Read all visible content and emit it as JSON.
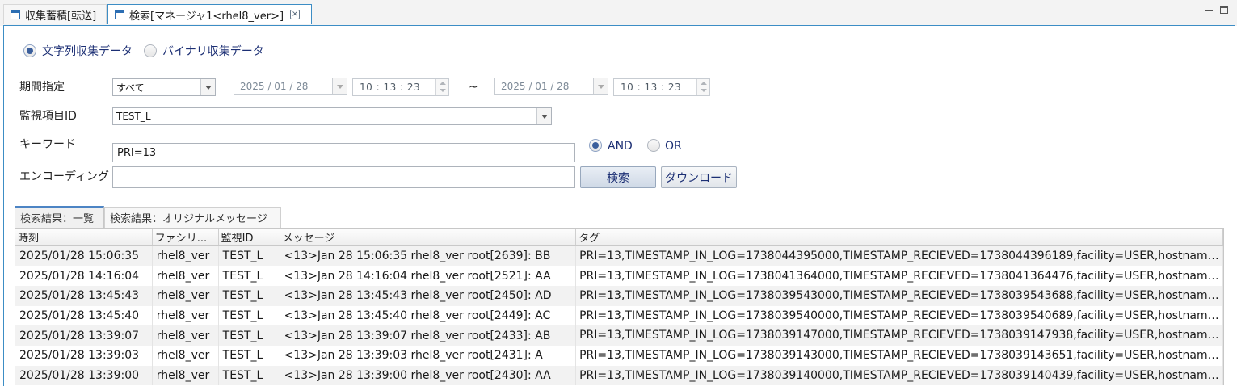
{
  "tabs": {
    "inactive_label": "収集蓄積[転送]",
    "active_label": "検索[マネージャ1<rhel8_ver>]"
  },
  "data_type": {
    "string_label": "文字列収集データ",
    "binary_label": "バイナリ収集データ",
    "selected": "string"
  },
  "period": {
    "label": "期間指定",
    "mode_value": "すべて",
    "from_date": "2025 / 01 / 28",
    "from_time": "10 : 13 : 23",
    "tilde": "~",
    "to_date": "2025 / 01 / 28",
    "to_time": "10 : 13 : 23"
  },
  "monitor": {
    "label": "監視項目ID",
    "value": "TEST_L"
  },
  "keyword": {
    "label": "キーワード",
    "value": "PRI=13",
    "and_label": "AND",
    "or_label": "OR",
    "selected": "AND"
  },
  "encoding": {
    "label": "エンコーディング",
    "value": ""
  },
  "buttons": {
    "search": "検索",
    "download": "ダウンロード"
  },
  "result_tabs": {
    "list": "検索結果：一覧",
    "original": "検索結果：オリジナルメッセージ"
  },
  "table": {
    "headers": [
      "時刻",
      "ファシリ...",
      "監視ID",
      "メッセージ",
      "タグ"
    ],
    "rows": [
      [
        "2025/01/28 15:06:35",
        "rhel8_ver",
        "TEST_L",
        "<13>Jan 28 15:06:35 rhel8_ver root[2639]: BB",
        "PRI=13,TIMESTAMP_IN_LOG=1738044395000,TIMESTAMP_RECIEVED=1738044396189,facility=USER,hostname..."
      ],
      [
        "2025/01/28 14:16:04",
        "rhel8_ver",
        "TEST_L",
        "<13>Jan 28 14:16:04 rhel8_ver root[2521]: AA",
        "PRI=13,TIMESTAMP_IN_LOG=1738041364000,TIMESTAMP_RECIEVED=1738041364476,facility=USER,hostname..."
      ],
      [
        "2025/01/28 13:45:43",
        "rhel8_ver",
        "TEST_L",
        "<13>Jan 28 13:45:43 rhel8_ver root[2450]: AD",
        "PRI=13,TIMESTAMP_IN_LOG=1738039543000,TIMESTAMP_RECIEVED=1738039543688,facility=USER,hostname..."
      ],
      [
        "2025/01/28 13:45:40",
        "rhel8_ver",
        "TEST_L",
        "<13>Jan 28 13:45:40 rhel8_ver root[2449]: AC",
        "PRI=13,TIMESTAMP_IN_LOG=1738039540000,TIMESTAMP_RECIEVED=1738039540689,facility=USER,hostname..."
      ],
      [
        "2025/01/28 13:39:07",
        "rhel8_ver",
        "TEST_L",
        "<13>Jan 28 13:39:07 rhel8_ver root[2433]: AB",
        "PRI=13,TIMESTAMP_IN_LOG=1738039147000,TIMESTAMP_RECIEVED=1738039147938,facility=USER,hostname..."
      ],
      [
        "2025/01/28 13:39:03",
        "rhel8_ver",
        "TEST_L",
        "<13>Jan 28 13:39:03 rhel8_ver root[2431]: A",
        "PRI=13,TIMESTAMP_IN_LOG=1738039143000,TIMESTAMP_RECIEVED=1738039143651,facility=USER,hostname..."
      ],
      [
        "2025/01/28 13:39:00",
        "rhel8_ver",
        "TEST_L",
        "<13>Jan 28 13:39:00 rhel8_ver root[2430]: AA",
        "PRI=13,TIMESTAMP_IN_LOG=1738039140000,TIMESTAMP_RECIEVED=1738039140439,facility=USER,hostname..."
      ]
    ]
  }
}
